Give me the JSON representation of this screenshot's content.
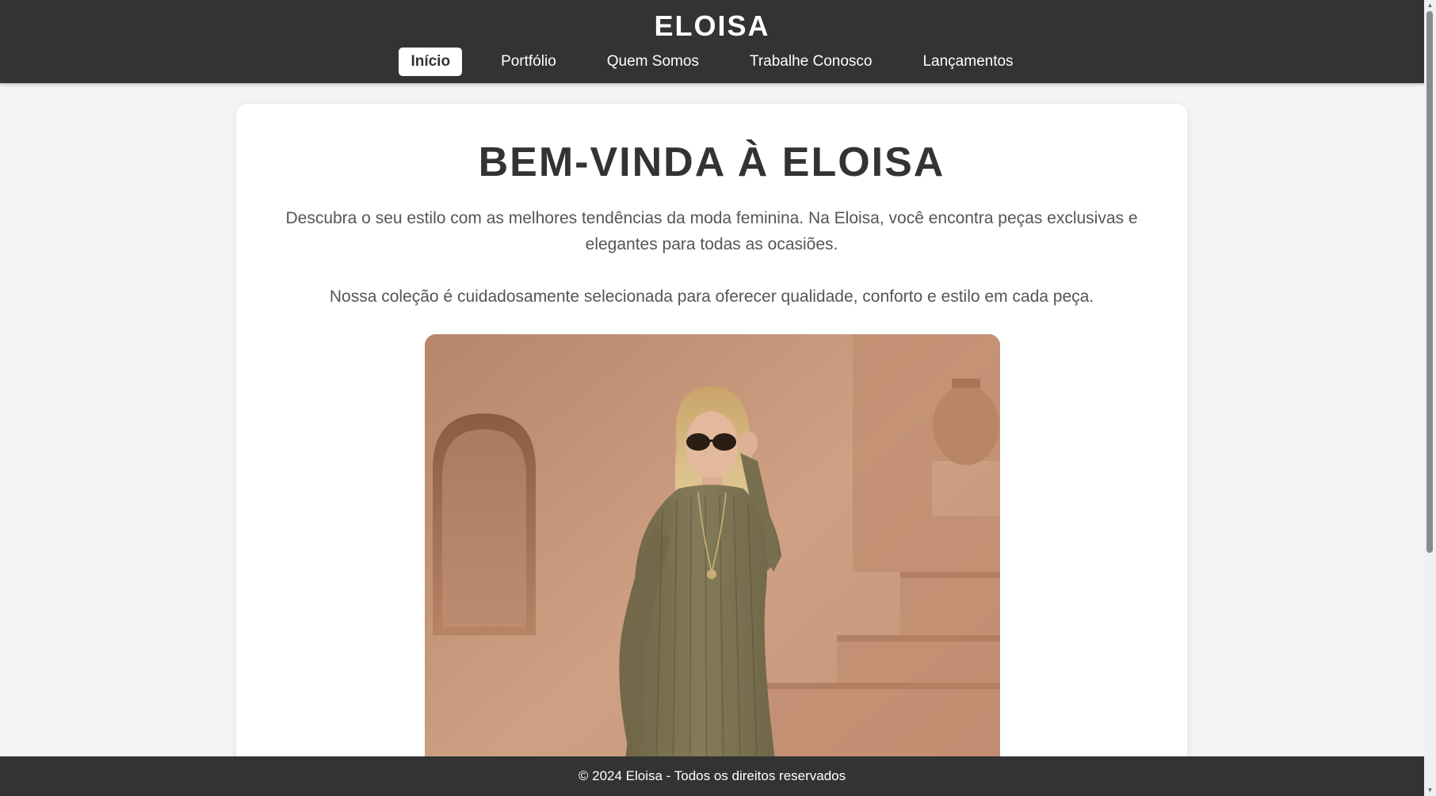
{
  "header": {
    "title": "ELOISA",
    "nav": [
      {
        "label": "Início",
        "active": true
      },
      {
        "label": "Portfólio",
        "active": false
      },
      {
        "label": "Quem Somos",
        "active": false
      },
      {
        "label": "Trabalhe Conosco",
        "active": false
      },
      {
        "label": "Lançamentos",
        "active": false
      }
    ]
  },
  "main": {
    "heading": "BEM-VINDA À ELOISA",
    "intro": "Descubra o seu estilo com as melhores tendências da moda feminina. Na Eloisa, você encontra peças exclusivas e elegantes para todas as ocasiões.",
    "collection_text": "Nossa coleção é cuidadosamente selecionada para oferecer qualidade, conforto e estilo em cada peça."
  },
  "footer": {
    "text": "© 2024 Eloisa - Todos os direitos reservados"
  },
  "colors": {
    "header_bg": "#333333",
    "page_bg": "#f4f4f4",
    "card_bg": "#ffffff",
    "text_muted": "#555555"
  },
  "icons": {
    "scroll_up": "scroll-up-icon",
    "scroll_down": "scroll-down-icon"
  }
}
